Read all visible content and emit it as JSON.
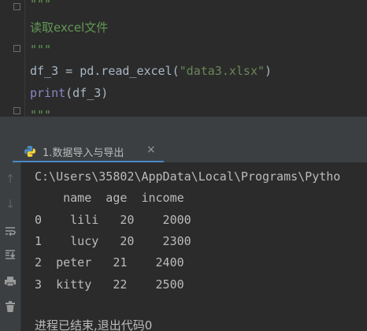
{
  "editor": {
    "lines": [
      {
        "kind": "doc",
        "text": "\"\"\""
      },
      {
        "kind": "doczh",
        "text": "读取excel文件"
      },
      {
        "kind": "doc",
        "text": "\"\"\""
      },
      {
        "kind": "code1",
        "var": "df_3 = pd.read_excel(",
        "str": "\"data3.xlsx\"",
        "close": ")"
      },
      {
        "kind": "code2",
        "kw": "print",
        "rest": "(df_3)"
      },
      {
        "kind": "doc",
        "text": "\"\"\""
      }
    ]
  },
  "run_tab": {
    "label": "1.数据导入与导出",
    "close": "×",
    "icon": "python-icon"
  },
  "toolbar": {
    "icons": [
      "up-arrow-icon",
      "down-arrow-icon",
      "soft-wrap-icon",
      "scroll-to-end-icon",
      "print-icon",
      "trash-icon"
    ]
  },
  "console": {
    "path": "C:\\Users\\35802\\AppData\\Local\\Programs\\Pytho",
    "header": "    name  age  income",
    "rows": [
      "0    lili   20    2000",
      "1    lucy   20    2300",
      "2  peter   21    2400",
      "3  kitty   22    2500"
    ],
    "exit_message": "进程已结束,退出代码0"
  },
  "colors": {
    "background": "#2b2b2b",
    "panel": "#3c3f41",
    "docstring": "#629755",
    "string": "#6a8759",
    "builtin": "#8888c6",
    "text": "#a9b7c6",
    "accent": "#4a88c7"
  }
}
